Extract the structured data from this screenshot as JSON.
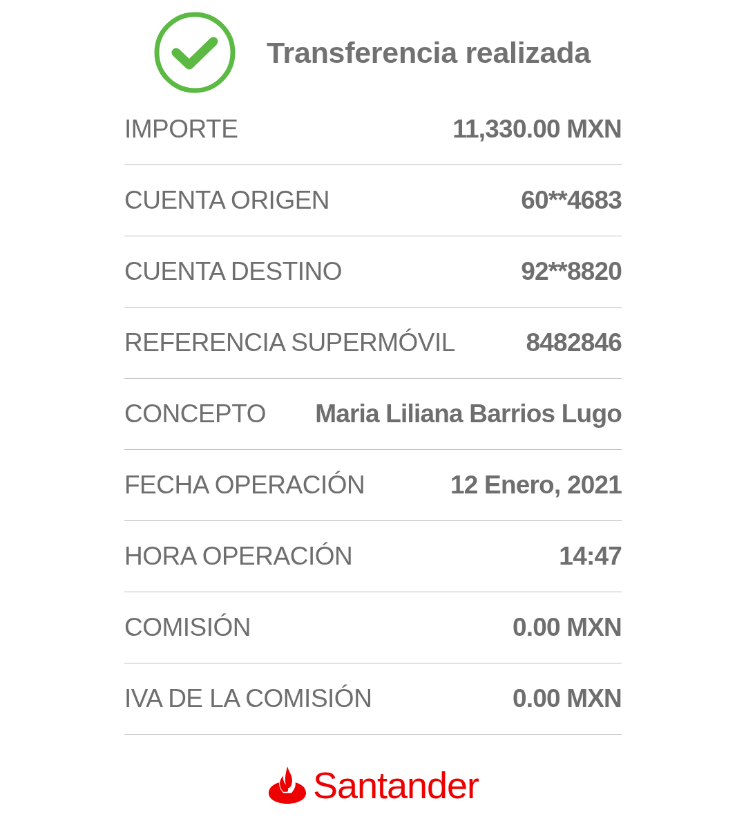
{
  "header": {
    "title": "Transferencia realizada",
    "succeeded": true
  },
  "rows": [
    {
      "label": "IMPORTE",
      "value": "11,330.00 MXN"
    },
    {
      "label": "CUENTA ORIGEN",
      "value": "60**4683"
    },
    {
      "label": "CUENTA DESTINO",
      "value": "92**8820"
    },
    {
      "label": "REFERENCIA SUPERMÓVIL",
      "value": "8482846"
    },
    {
      "label": "CONCEPTO",
      "value": "Maria Liliana Barrios Lugo"
    },
    {
      "label": "FECHA OPERACIÓN",
      "value": "12 Enero, 2021"
    },
    {
      "label": "HORA OPERACIÓN",
      "value": "14:47"
    },
    {
      "label": "COMISIÓN",
      "value": "0.00 MXN"
    },
    {
      "label": "IVA DE LA COMISIÓN",
      "value": "0.00 MXN"
    }
  ],
  "footer": {
    "brand": "Santander"
  }
}
